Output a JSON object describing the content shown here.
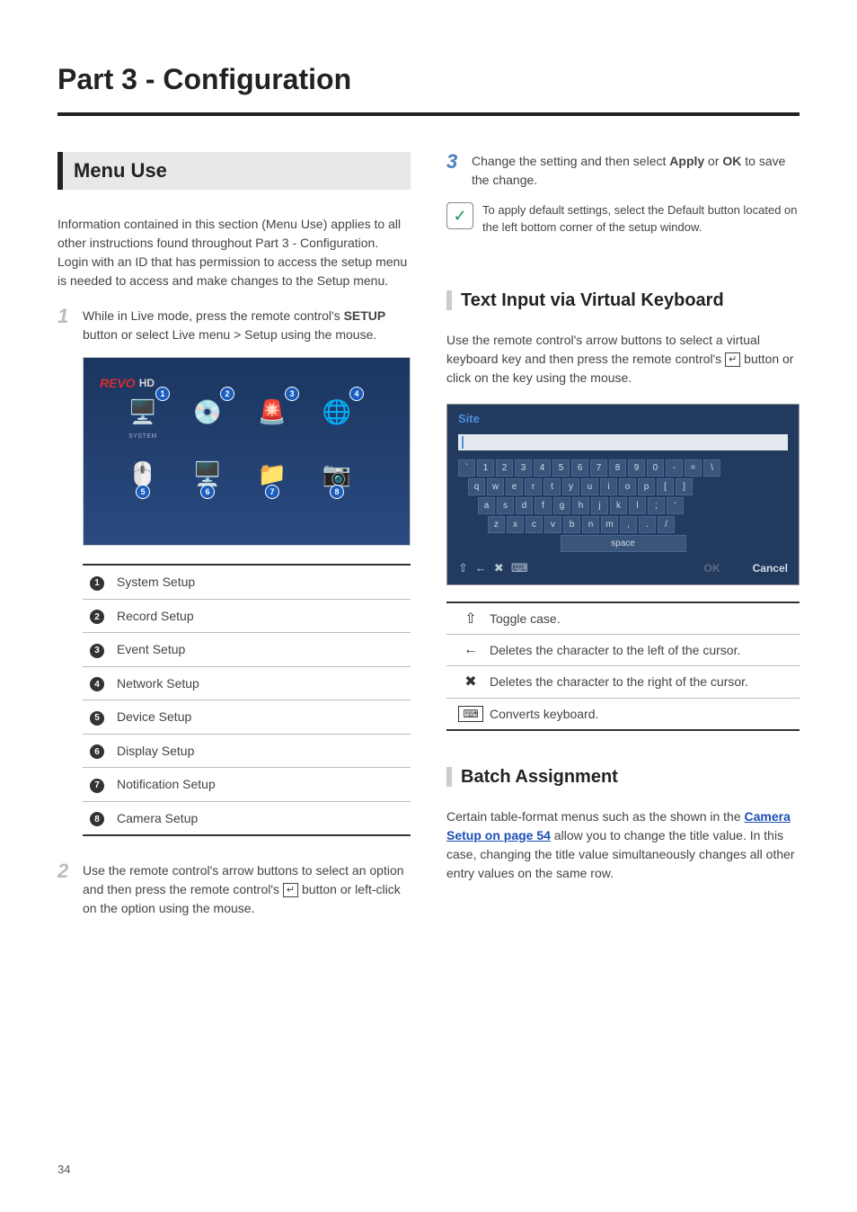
{
  "partTitle": "Part 3 - Configuration",
  "leftCol": {
    "menuHeading": "Menu Use",
    "intro": "Information contained in this section (Menu Use) applies to all other instructions found throughout Part 3 - Configuration.\nLogin with an ID that has permission to access the setup menu is needed to access and make changes to the Setup menu.",
    "step1": {
      "num": "1",
      "textA": "While in Live mode, press the remote control's ",
      "setup": "SETUP",
      "textB": " button or select Live menu > Setup using the mouse."
    },
    "screenshot": {
      "logo1": "REVO",
      "logo2": "HD",
      "iconLabel": "SYSTEM",
      "markers": [
        "1",
        "2",
        "3",
        "4",
        "5",
        "6",
        "7",
        "8"
      ]
    },
    "setupRows": [
      {
        "n": "1",
        "label": "System Setup"
      },
      {
        "n": "2",
        "label": "Record Setup"
      },
      {
        "n": "3",
        "label": "Event Setup"
      },
      {
        "n": "4",
        "label": "Network Setup"
      },
      {
        "n": "5",
        "label": "Device Setup"
      },
      {
        "n": "6",
        "label": "Display Setup"
      },
      {
        "n": "7",
        "label": "Notification Setup"
      },
      {
        "n": "8",
        "label": "Camera Setup"
      }
    ],
    "step2": {
      "num": "2",
      "textA": "Use the remote control's arrow buttons to select an option and then press the remote control's ",
      "enter": "↵",
      "textB": " button or left-click on the option using the mouse."
    }
  },
  "rightCol": {
    "step3": {
      "num": "3",
      "textA": "Change the setting and then select ",
      "apply": "Apply",
      "or": " or ",
      "ok": "OK",
      "textB": " to save the change."
    },
    "note": "To apply default settings, select the Default button located on the left bottom corner of the setup window.",
    "subHeading1": "Text Input via Virtual Keyboard",
    "kbdIntroA": "Use the remote control's arrow buttons to select a virtual keyboard key and then press the remote control's ",
    "kbdEnter": "↵",
    "kbdIntroB": " button or click on the key using the mouse.",
    "kbd": {
      "title": "Site",
      "row1": [
        "`",
        "1",
        "2",
        "3",
        "4",
        "5",
        "6",
        "7",
        "8",
        "9",
        "0",
        "-",
        "=",
        "\\"
      ],
      "row2": [
        "q",
        "w",
        "e",
        "r",
        "t",
        "y",
        "u",
        "i",
        "o",
        "p",
        "[",
        "]"
      ],
      "row3": [
        "a",
        "s",
        "d",
        "f",
        "g",
        "h",
        "j",
        "k",
        "l",
        ";",
        "'"
      ],
      "row4": [
        "z",
        "x",
        "c",
        "v",
        "b",
        "n",
        "m",
        ",",
        ".",
        "/"
      ],
      "space": "space",
      "bl": [
        "⇧",
        "←",
        "✖",
        "⌨"
      ],
      "ok": "OK",
      "cancel": "Cancel"
    },
    "symRows": [
      {
        "icon": "⇧",
        "text": "Toggle case."
      },
      {
        "icon": "←",
        "text": "Deletes the character to the left of the cursor."
      },
      {
        "icon": "✖",
        "text": "Deletes the character to the right of the cursor."
      },
      {
        "icon": "⌨",
        "text": "Converts keyboard.",
        "boxed": true
      }
    ],
    "subHeading2": "Batch Assignment",
    "batchA": "Certain table-format menus such as the shown in the ",
    "batchLink": "Camera Setup on page 54",
    "batchB": " allow you to change the title value. In this case, changing the title value simultaneously changes all other entry values on the same row."
  },
  "pageNum": "34"
}
